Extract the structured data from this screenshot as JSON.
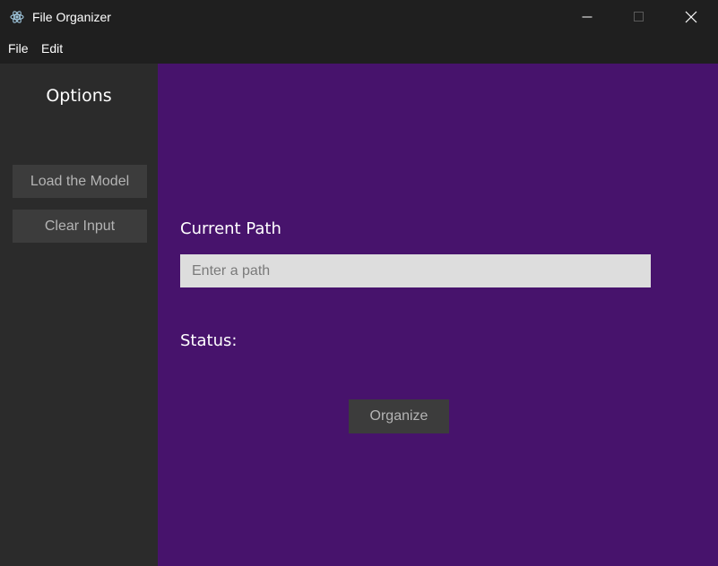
{
  "window": {
    "title": "File Organizer",
    "icon": "electron-atom-icon"
  },
  "menu": {
    "items": [
      {
        "label": "File"
      },
      {
        "label": "Edit"
      }
    ]
  },
  "sidebar": {
    "title": "Options",
    "buttons": [
      {
        "label": "Load the Model"
      },
      {
        "label": "Clear Input"
      }
    ]
  },
  "main": {
    "path_label": "Current Path",
    "path_input": {
      "value": "",
      "placeholder": "Enter a path"
    },
    "status_label": "Status:",
    "status_value": "",
    "organize_label": "Organize"
  },
  "colors": {
    "titlebar": "#1f1f1f",
    "sidebar": "#2b2b2b",
    "main_panel": "#47136c",
    "button": "#3c3c3c",
    "button_text": "#b4b4b4",
    "input_bg": "#dddddd"
  }
}
